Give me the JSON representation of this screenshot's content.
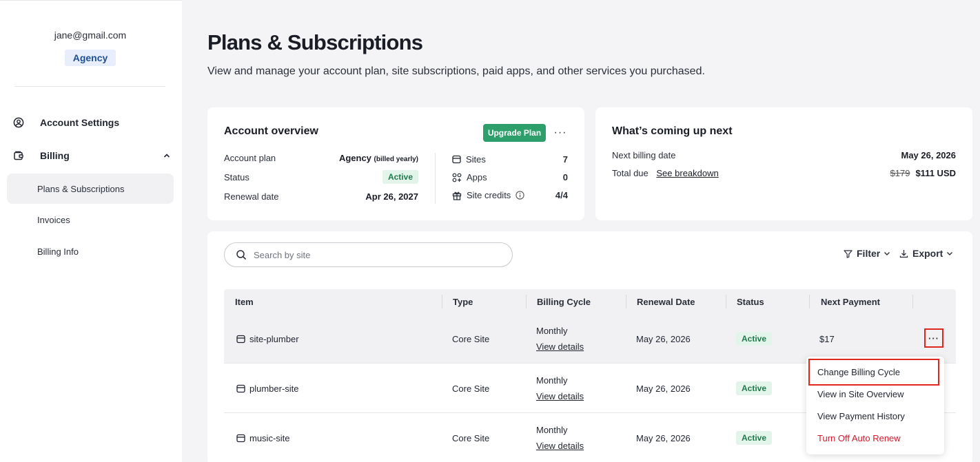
{
  "sidebar": {
    "email": "jane@gmail.com",
    "plan_badge": "Agency",
    "nav": {
      "account_settings": "Account Settings",
      "billing": "Billing",
      "plans_subscriptions": "Plans & Subscriptions",
      "invoices": "Invoices",
      "billing_info": "Billing Info"
    }
  },
  "header": {
    "title": "Plans & Subscriptions",
    "description": "View and manage your account plan, site subscriptions, paid apps, and other services you purchased."
  },
  "overview": {
    "title": "Account overview",
    "upgrade_label": "Upgrade Plan",
    "more_label": "···",
    "account_plan_label": "Account plan",
    "account_plan_value": "Agency",
    "account_plan_note": "(billed yearly)",
    "status_label": "Status",
    "status_value": "Active",
    "renewal_label": "Renewal date",
    "renewal_value": "Apr 26, 2027",
    "stats": [
      {
        "label": "Sites",
        "value": "7",
        "icon": "site-icon"
      },
      {
        "label": "Apps",
        "value": "0",
        "icon": "apps-icon"
      },
      {
        "label": "Site credits",
        "value": "4/4",
        "icon": "gift-icon"
      }
    ]
  },
  "next": {
    "title": "What’s coming up next",
    "billing_date_label": "Next billing date",
    "billing_date_value": "May 26, 2026",
    "total_due_label": "Total due",
    "breakdown_link": "See breakdown",
    "old_price": "$179",
    "new_price": "$111 USD"
  },
  "table": {
    "search_placeholder": "Search by site",
    "filter_label": "Filter",
    "export_label": "Export",
    "columns": [
      "Item",
      "Type",
      "Billing Cycle",
      "Renewal Date",
      "Status",
      "Next Payment"
    ],
    "rows": [
      {
        "item": "site-plumber",
        "type": "Core Site",
        "cycle": "Monthly",
        "details": "View details",
        "renewal": "May 26, 2026",
        "status": "Active",
        "payment": "$17"
      },
      {
        "item": "plumber-site",
        "type": "Core Site",
        "cycle": "Monthly",
        "details": "View details",
        "renewal": "May 26, 2026",
        "status": "Active",
        "payment": ""
      },
      {
        "item": "music-site",
        "type": "Core Site",
        "cycle": "Monthly",
        "details": "View details",
        "renewal": "May 26, 2026",
        "status": "Active",
        "payment": ""
      }
    ],
    "row_more_label": "···"
  },
  "dropdown": {
    "items": [
      "Change Billing Cycle",
      "View in Site Overview",
      "View Payment History",
      "Turn Off Auto Renew"
    ]
  },
  "colors": {
    "accent_green": "#2e9e6b",
    "status_bg": "#e3f4ea",
    "status_text": "#1f7a4d",
    "danger": "#d4182a",
    "highlight": "#e0271f"
  }
}
